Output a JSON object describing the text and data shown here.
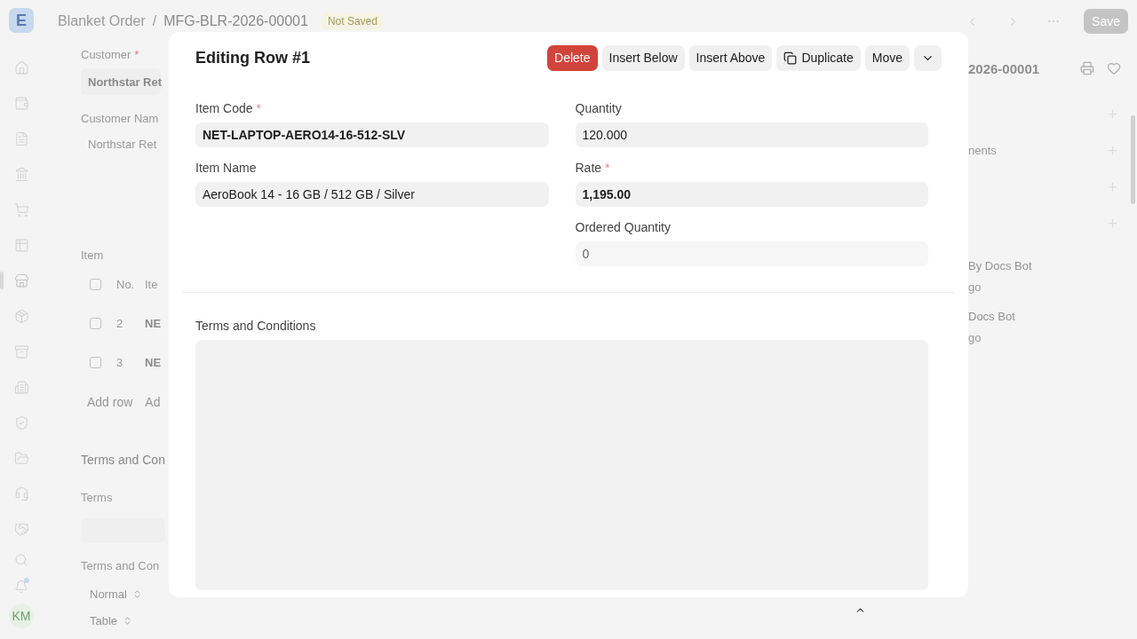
{
  "sidebar": {
    "logo": "E",
    "items": [
      {
        "selected": false
      },
      {
        "selected": false
      },
      {
        "selected": false
      },
      {
        "selected": false
      },
      {
        "selected": false
      },
      {
        "selected": false
      },
      {
        "selected": true
      },
      {
        "selected": false
      },
      {
        "selected": false
      },
      {
        "selected": false
      },
      {
        "selected": false
      },
      {
        "selected": false
      },
      {
        "selected": false
      },
      {
        "selected": false
      }
    ],
    "notifications_unread": true,
    "avatar": "KM"
  },
  "header": {
    "breadcrumb": [
      "Blanket Order",
      "MFG-BLR-2026-00001"
    ],
    "separator": "/",
    "status": "Not Saved",
    "save": "Save"
  },
  "required_mark": "*",
  "form": {
    "customer": {
      "label": "Customer",
      "required": true,
      "value": "Northstar Ret"
    },
    "customer_name": {
      "label": "Customer Nam",
      "value": "Northstar Ret"
    },
    "items": {
      "label": "Item",
      "select_all_checked": false,
      "columns": [
        "No.",
        "Ite"
      ],
      "rows": [
        {
          "no": "2",
          "code": "NE",
          "checked": false
        },
        {
          "no": "3",
          "code": "NE",
          "checked": false
        }
      ],
      "buttons": [
        "Add row",
        "Ad"
      ]
    },
    "section": "Terms and Con",
    "terms_label": "Terms",
    "terms_and_conditions_label": "Terms and Con",
    "selects": [
      "Normal",
      "Table"
    ]
  },
  "side_panel": {
    "title": "2026-00001",
    "section_link": "nents",
    "activity": [
      {
        "text": "By Docs Bot",
        "time": "go"
      },
      {
        "text": "Docs Bot",
        "time": "go"
      }
    ]
  },
  "dialog": {
    "title": "Editing Row #1",
    "actions": [
      {
        "label": "Delete",
        "kind": "danger"
      },
      {
        "label": "Insert Below",
        "kind": "plain"
      },
      {
        "label": "Insert Above",
        "kind": "plain"
      },
      {
        "label": "Duplicate",
        "kind": "copy"
      },
      {
        "label": "Move",
        "kind": "plain"
      },
      {
        "kind": "menu"
      }
    ],
    "left_fields": [
      {
        "label": "Item Code",
        "required": true,
        "value": "NET-LAPTOP-AERO14-16-512-SLV",
        "bold": true,
        "read_only": false
      },
      {
        "label": "Item Name",
        "required": false,
        "value": "AeroBook 14 - 16 GB / 512 GB / Silver",
        "bold": false,
        "read_only": false
      }
    ],
    "right_fields": [
      {
        "label": "Quantity",
        "required": false,
        "value": "120.000",
        "bold": false,
        "read_only": false
      },
      {
        "label": "Rate",
        "required": true,
        "value": "1,195.00",
        "bold": true,
        "read_only": false
      },
      {
        "label": "Ordered Quantity",
        "required": false,
        "value": "0",
        "bold": false,
        "read_only": true
      }
    ],
    "textarea_label": "Terms and Conditions"
  }
}
